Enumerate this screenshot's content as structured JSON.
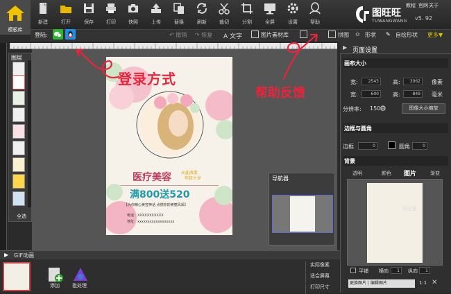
{
  "app": {
    "home_label": "模板库",
    "logo_text": "图旺旺",
    "logo_sub": "TUWANGWANG",
    "version": "v5. 92",
    "top_links": [
      "教程",
      "官网",
      "关于"
    ]
  },
  "toolbar": {
    "items": [
      {
        "label": "新建",
        "icon": "new-file-icon"
      },
      {
        "label": "打开",
        "icon": "folder-open-icon"
      },
      {
        "label": "保存",
        "icon": "save-icon"
      },
      {
        "label": "打印",
        "icon": "printer-icon"
      },
      {
        "label": "快照",
        "icon": "camera-icon"
      },
      {
        "label": "上传",
        "icon": "upload-icon"
      },
      {
        "label": "替换",
        "icon": "replace-icon"
      },
      {
        "label": "刷新",
        "icon": "refresh-icon"
      },
      {
        "label": "裁切",
        "icon": "scissors-icon"
      },
      {
        "label": "分割",
        "icon": "crop-split-icon"
      },
      {
        "label": "全屏",
        "icon": "monitor-icon"
      },
      {
        "label": "设置",
        "icon": "gear-icon"
      },
      {
        "label": "帮助",
        "icon": "help-person-icon"
      }
    ]
  },
  "subbar": {
    "login_label": "登陆:",
    "undo": "撤销",
    "redo": "恢复",
    "text": "文字",
    "material": "图片素材库",
    "puzzle": "拼图",
    "shape": "形状",
    "custom_shape": "自绘形状",
    "more": "更多▼"
  },
  "layers": {
    "title": "图层",
    "select_all": "全选"
  },
  "poster": {
    "title": "医疗美容",
    "sub1": "从此改变",
    "sub2": "年轻十岁",
    "promo": "满800送520",
    "note": "【为你精心美容神话 点燃你的美丽风采】",
    "phone": "电话：XXXXXXXXXXX",
    "address": "地址：xxxxxxxxxxxxxxxxxx"
  },
  "annotations": {
    "login": "登录方式",
    "help": "帮助反馈"
  },
  "navigator": {
    "title": "导航器"
  },
  "gif": {
    "label": "GIF动画"
  },
  "bottom": {
    "add": "添加",
    "batch": "批处理",
    "actual_pixels": "实际像素",
    "fit_screen": "适合屏幕",
    "print_size": "打印尺寸"
  },
  "panel": {
    "title": "页面设置",
    "canvas_size": "画布大小",
    "width_label": "宽:",
    "height_label": "高:",
    "width_px": "2543",
    "height_px": "3062",
    "unit_px": "像素",
    "width_mm": "600",
    "height_mm": "849",
    "unit_mm": "毫米",
    "resolution_label": "分辨率:",
    "resolution": "150",
    "scale_button": "图像大小缩放",
    "border_section": "边框与圆角",
    "border_label": "边框",
    "border_value": "0",
    "radius_label": "圆角",
    "radius_value": "0",
    "bg_section": "背景",
    "bg_tabs": [
      "透明",
      "颜色",
      "图片",
      "渐变"
    ],
    "bg_hint": "到这里",
    "tile_label": "平铺",
    "h_label": "横向",
    "h_value": "1",
    "v_label": "纵向",
    "v_value": "1",
    "replace": "更换图片 | 编辑图片",
    "ratio": "1:1"
  }
}
